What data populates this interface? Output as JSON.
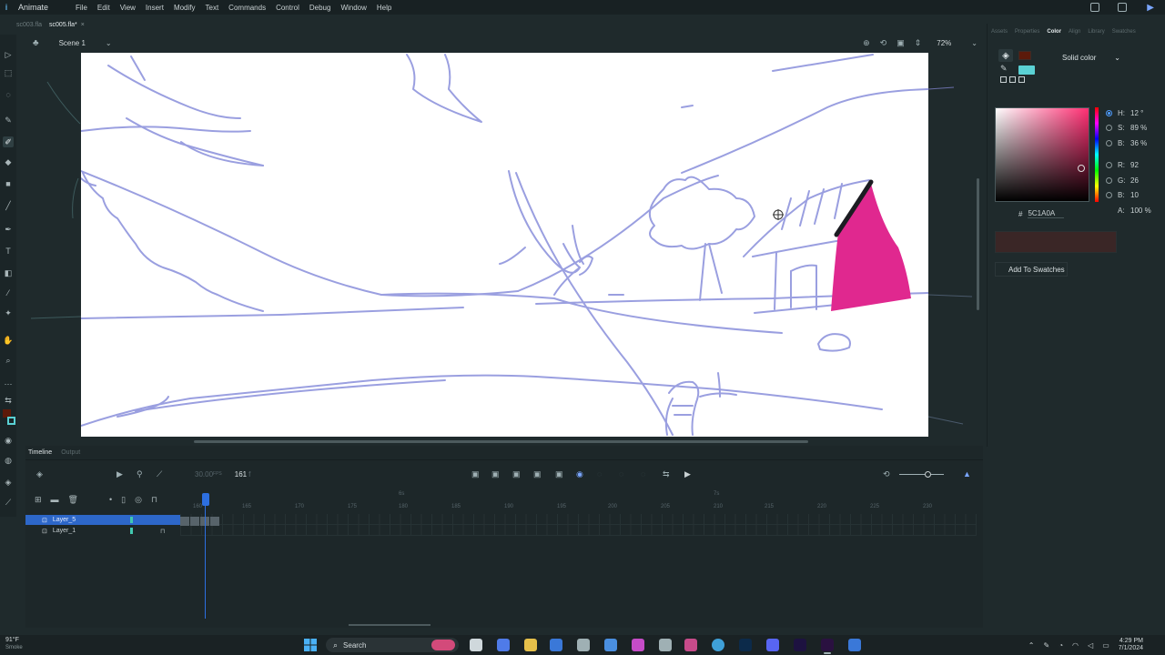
{
  "app": {
    "name": "Animate"
  },
  "menu": [
    "File",
    "Edit",
    "View",
    "Insert",
    "Modify",
    "Text",
    "Commands",
    "Control",
    "Debug",
    "Window",
    "Help"
  ],
  "file_tabs": [
    {
      "label": "sc003.fla",
      "active": false
    },
    {
      "label": "sc005.fla*",
      "active": true
    }
  ],
  "scene": {
    "label": "Scene 1",
    "zoom": "72%"
  },
  "panel_tabs": [
    "Assets",
    "Properties",
    "Color",
    "Align",
    "Library",
    "Swatches"
  ],
  "color_panel": {
    "type": "Solid color",
    "hsb": [
      {
        "label": "H:",
        "value": "12 °",
        "selected": true
      },
      {
        "label": "S:",
        "value": "89 %",
        "selected": false
      },
      {
        "label": "B:",
        "value": "36 %",
        "selected": false
      }
    ],
    "rgb": [
      {
        "label": "R:",
        "value": "92"
      },
      {
        "label": "G:",
        "value": "26"
      },
      {
        "label": "B:",
        "value": "10"
      },
      {
        "label": "A:",
        "value": "100 %"
      }
    ],
    "hex_prefix": "#",
    "hex": "5C1A0A",
    "add_swatches": "Add To Swatches",
    "fill_color": "#5C1A0A",
    "stroke_color": "#5ad1d4"
  },
  "timeline": {
    "tabs": [
      "Timeline",
      "Output"
    ],
    "fps": "30.00",
    "fps_unit": "FPS",
    "current_frame": "161",
    "frame_suffix": "f",
    "ruler": [
      "160",
      "165",
      "170",
      "175",
      "180",
      "185",
      "190",
      "195",
      "200",
      "205",
      "210",
      "215",
      "220",
      "225",
      "230"
    ],
    "ruler_secondary": [
      "6s",
      "7s"
    ],
    "layers": [
      {
        "name": "Layer_5",
        "selected": true
      },
      {
        "name": "Layer_1",
        "selected": false
      }
    ]
  },
  "taskbar": {
    "weather_temp": "91°F",
    "weather_desc": "Smoke",
    "search": "Search",
    "time": "4:29 PM",
    "date": "7/1/2024"
  },
  "colors": {
    "accent": "#2d67c9",
    "stroke": "#9a9fe0",
    "roof_fill": "#e0288f"
  }
}
